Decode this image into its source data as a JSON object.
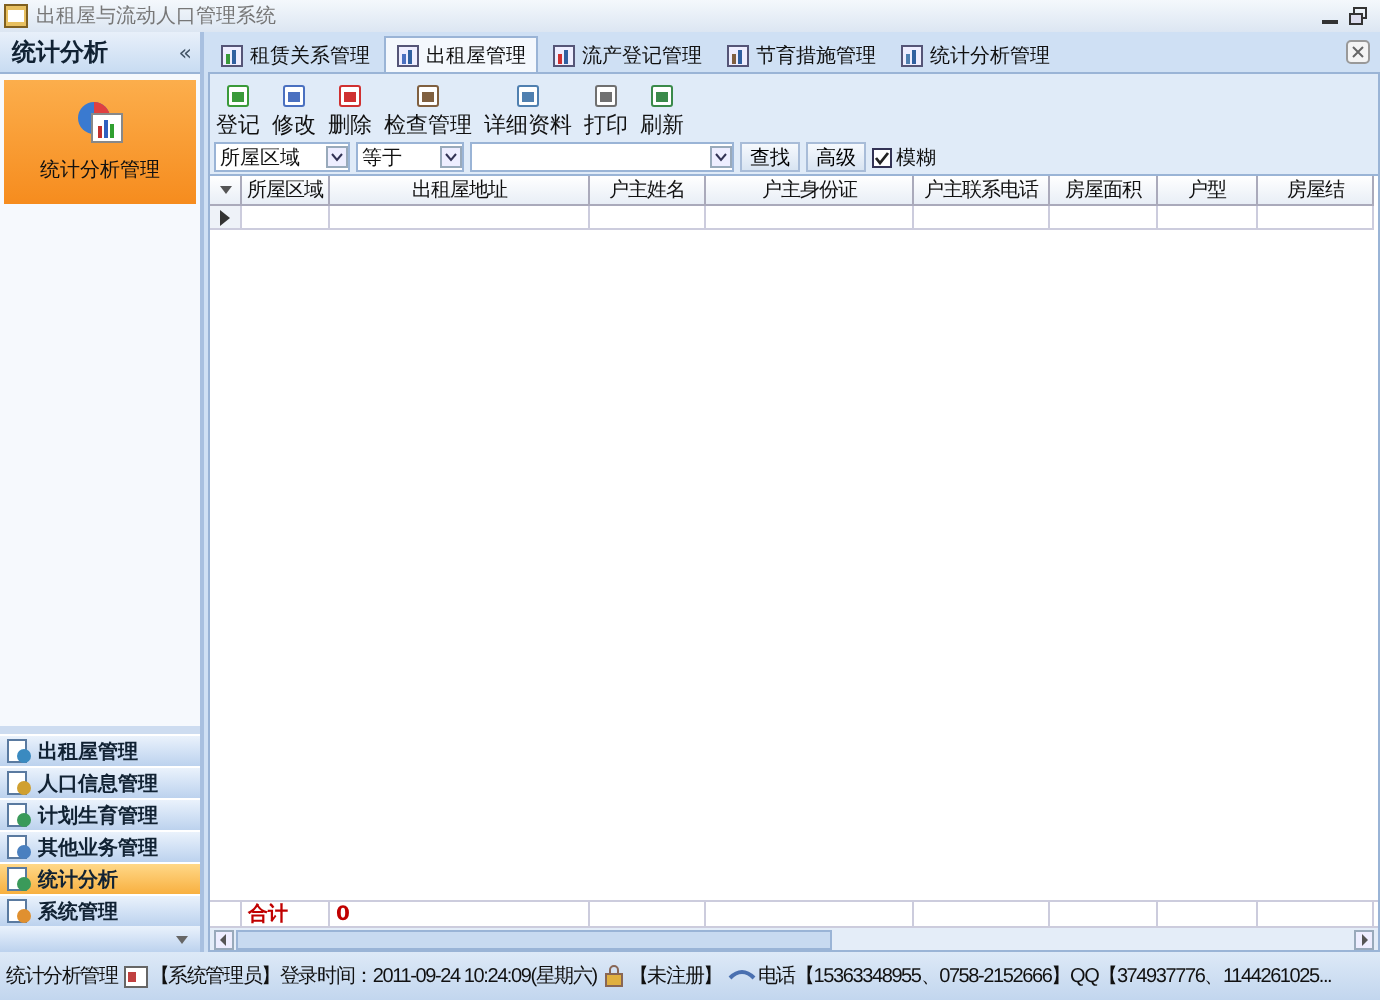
{
  "window": {
    "title": "出租屋与流动人口管理系统"
  },
  "sidebar": {
    "title": "统计分析",
    "collapse": "«",
    "panel_items": [
      {
        "label": "统计分析管理",
        "selected": true
      }
    ],
    "nav_items": [
      {
        "label": "出租屋管理",
        "selected": false
      },
      {
        "label": "人口信息管理",
        "selected": false
      },
      {
        "label": "计划生育管理",
        "selected": false
      },
      {
        "label": "其他业务管理",
        "selected": false
      },
      {
        "label": "统计分析",
        "selected": true
      },
      {
        "label": "系统管理",
        "selected": false
      }
    ]
  },
  "tabs": [
    {
      "label": "租赁关系管理",
      "selected": false
    },
    {
      "label": "出租屋管理",
      "selected": true
    },
    {
      "label": "流产登记管理",
      "selected": false
    },
    {
      "label": "节育措施管理",
      "selected": false
    },
    {
      "label": "统计分析管理",
      "selected": false
    }
  ],
  "toolbar": [
    "登记",
    "修改",
    "删除",
    "检查管理",
    "详细资料",
    "打印",
    "刷新"
  ],
  "filter": {
    "field": "所屋区域",
    "operator": "等于",
    "search": "查找",
    "advanced": "高级",
    "fuzzy": {
      "label": "模糊",
      "checked": true
    }
  },
  "table": {
    "columns": [
      "所屋区域",
      "出租屋地址",
      "户主姓名",
      "户主身份证",
      "户主联系电话",
      "房屋面积",
      "户型",
      "房屋结"
    ],
    "rows": [
      {
        "selected": true
      }
    ],
    "footer": [
      "合计",
      "0"
    ]
  },
  "status_bar": {
    "module": "统计分析管理",
    "user": "【系统管理员】登录时间：2011-09-24  10:24:09(星期六)",
    "registration": "【未注册】",
    "contact": "电话【15363348955、0758-2152666】QQ【374937776、1144261025..."
  }
}
